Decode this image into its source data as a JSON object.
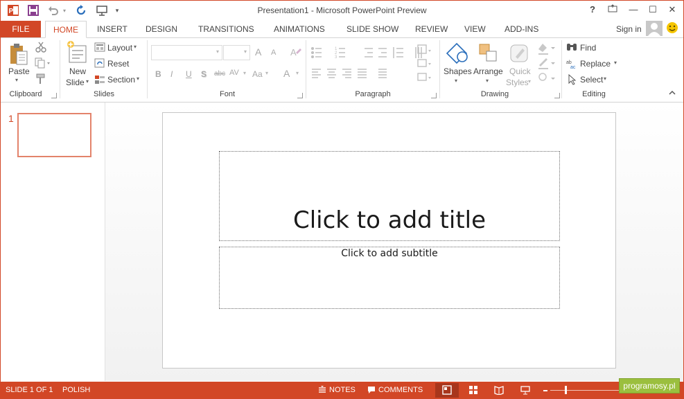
{
  "window": {
    "title": "Presentation1 - Microsoft PowerPoint Preview",
    "controls": {
      "help": "?",
      "minimize": "—",
      "maximize": "☐",
      "close": "✕"
    }
  },
  "quick_access": {
    "icons": [
      "powerpoint-app-icon",
      "save-icon",
      "undo-icon",
      "redo-icon",
      "present-icon",
      "customize-icon"
    ]
  },
  "tabs": {
    "file": "FILE",
    "items": [
      "HOME",
      "INSERT",
      "DESIGN",
      "TRANSITIONS",
      "ANIMATIONS",
      "SLIDE SHOW",
      "REVIEW",
      "VIEW",
      "ADD-INS"
    ],
    "active": "HOME"
  },
  "account": {
    "signin": "Sign in"
  },
  "ribbon": {
    "clipboard": {
      "paste": "Paste",
      "label": "Clipboard"
    },
    "slides": {
      "new_slide_1": "New",
      "new_slide_2": "Slide",
      "layout": "Layout",
      "reset": "Reset",
      "section": "Section",
      "label": "Slides"
    },
    "font": {
      "label": "Font",
      "bold": "B",
      "italic": "I",
      "underline": "U",
      "shadow": "S",
      "strike": "abc",
      "spacing": "AV",
      "case": "Aa",
      "color": "A",
      "grow": "A",
      "shrink": "A"
    },
    "paragraph": {
      "label": "Paragraph"
    },
    "drawing": {
      "shapes": "Shapes",
      "arrange": "Arrange",
      "quick_styles_1": "Quick",
      "quick_styles_2": "Styles",
      "label": "Drawing"
    },
    "editing": {
      "find": "Find",
      "replace": "Replace",
      "select": "Select",
      "label": "Editing"
    }
  },
  "thumbnails": [
    {
      "number": "1"
    }
  ],
  "slide": {
    "title_placeholder": "Click to add title",
    "subtitle_placeholder": "Click to add subtitle"
  },
  "status": {
    "slide_info": "SLIDE 1 OF 1",
    "language": "POLISH",
    "notes": "NOTES",
    "comments": "COMMENTS",
    "zoom_icons": [
      "zoom-out-icon",
      "zoom-slider",
      "zoom-in-icon"
    ]
  },
  "watermark": {
    "text": "programosy.pl"
  },
  "colors": {
    "accent": "#d24726",
    "badge": "#9bbf3e"
  }
}
